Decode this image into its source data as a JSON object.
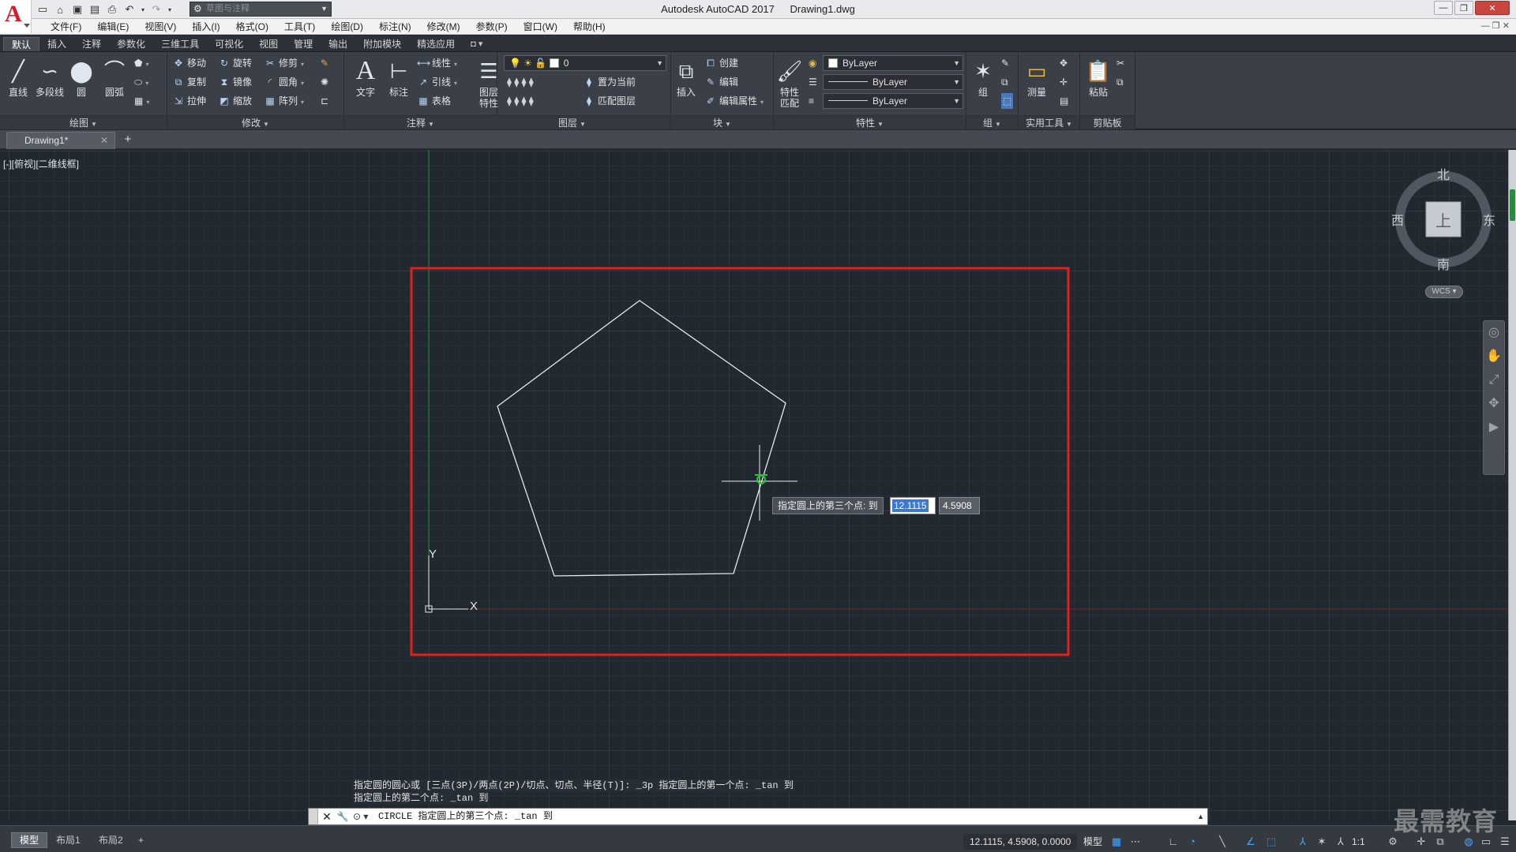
{
  "app": {
    "title": "Autodesk AutoCAD 2017",
    "document": "Drawing1.dwg",
    "workspace": "草图与注释"
  },
  "menu": {
    "items": [
      "文件(F)",
      "编辑(E)",
      "视图(V)",
      "插入(I)",
      "格式(O)",
      "工具(T)",
      "绘图(D)",
      "标注(N)",
      "修改(M)",
      "参数(P)",
      "窗口(W)",
      "帮助(H)"
    ]
  },
  "ribbon": {
    "tabs": [
      "默认",
      "插入",
      "注释",
      "参数化",
      "三维工具",
      "可视化",
      "视图",
      "管理",
      "输出",
      "附加模块",
      "精选应用"
    ],
    "active_tab": "默认",
    "draw": {
      "title": "绘图",
      "line": "直线",
      "polyline": "多段线",
      "circle": "圆",
      "arc": "圆弧"
    },
    "modify": {
      "title": "修改",
      "move": "移动",
      "rotate": "旋转",
      "trim": "修剪",
      "copy": "复制",
      "mirror": "镜像",
      "fillet": "圆角",
      "stretch": "拉伸",
      "scale": "缩放",
      "array": "阵列"
    },
    "annotation": {
      "title": "注释",
      "text": "文字",
      "dimension": "标注",
      "linear": "线性",
      "leader": "引线",
      "table": "表格"
    },
    "layers": {
      "title": "图层",
      "layer_properties": "图层\n特性",
      "layer_properties_a": "图层",
      "layer_properties_b": "特性",
      "current_layer": "0",
      "set_current": "置为当前",
      "match_layer": "匹配图层"
    },
    "block": {
      "title": "块",
      "insert": "插入",
      "create": "创建",
      "edit": "编辑",
      "edit_attributes": "编辑属性"
    },
    "properties": {
      "title": "特性",
      "match_a": "特性",
      "match_b": "匹配",
      "color": "ByLayer",
      "linetype": "ByLayer",
      "lineweight": "ByLayer"
    },
    "groups": {
      "title": "组",
      "group": "组"
    },
    "utilities": {
      "title": "实用工具",
      "measure": "测量"
    },
    "clipboard": {
      "title": "剪贴板",
      "paste": "粘贴"
    }
  },
  "file_tab": {
    "name": "Drawing1*"
  },
  "viewport": {
    "label": "[-][俯视][二维线框]"
  },
  "viewcube": {
    "north": "北",
    "south": "南",
    "east": "东",
    "west": "西",
    "face": "上",
    "wcs": "WCS"
  },
  "ucs": {
    "x_label": "X",
    "y_label": "Y"
  },
  "dynamic_input": {
    "prompt": "指定圆上的第三个点: 到",
    "x_value": "12.1115",
    "y_value": "4.5908"
  },
  "command": {
    "history": [
      "指定圆的圆心或 [三点(3P)/两点(2P)/切点、切点、半径(T)]: _3p 指定圆上的第一个点: _tan 到",
      "指定圆上的第二个点: _tan 到"
    ],
    "current": "CIRCLE 指定圆上的第三个点: _tan 到"
  },
  "status": {
    "layouts": [
      "模型",
      "布局1",
      "布局2"
    ],
    "coords": "12.1115, 4.5908, 0.0000",
    "mode": "模型",
    "scale": "1:1"
  },
  "watermark": "最需教育",
  "colors": {
    "canvas_bg": "#212830",
    "highlight_rect": "#e0201c",
    "ucs_y_axis": "#1f8a2a",
    "ucs_x_axis": "#8a2323",
    "geometry": "#e8e8e8",
    "ribbon_bg": "#3b4048"
  }
}
